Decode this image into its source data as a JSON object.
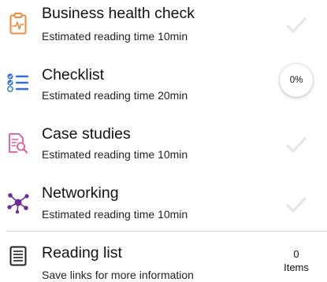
{
  "items": [
    {
      "title": "Business health check",
      "subtitle": "Estimated reading time 10min",
      "icon": "clipboard-health-icon",
      "status": "complete"
    },
    {
      "title": "Checklist",
      "subtitle": "Estimated reading time 20min",
      "icon": "checklist-icon",
      "status": "in-progress",
      "progress_label": "0%"
    },
    {
      "title": "Case studies",
      "subtitle": "Estimated reading time 10min",
      "icon": "document-search-icon",
      "status": "complete"
    },
    {
      "title": "Networking",
      "subtitle": "Estimated reading time 10min",
      "icon": "network-nodes-icon",
      "status": "complete"
    }
  ],
  "reading_list": {
    "title": "Reading list",
    "subtitle": "Save links for more information",
    "icon": "reading-list-icon",
    "count": "0",
    "count_label": "Items"
  },
  "colors": {
    "orange": "#f08a3c",
    "blue": "#2f6fd6",
    "pink": "#e8559a",
    "purple": "#6a2c9c",
    "check": "#e6e6e6"
  }
}
